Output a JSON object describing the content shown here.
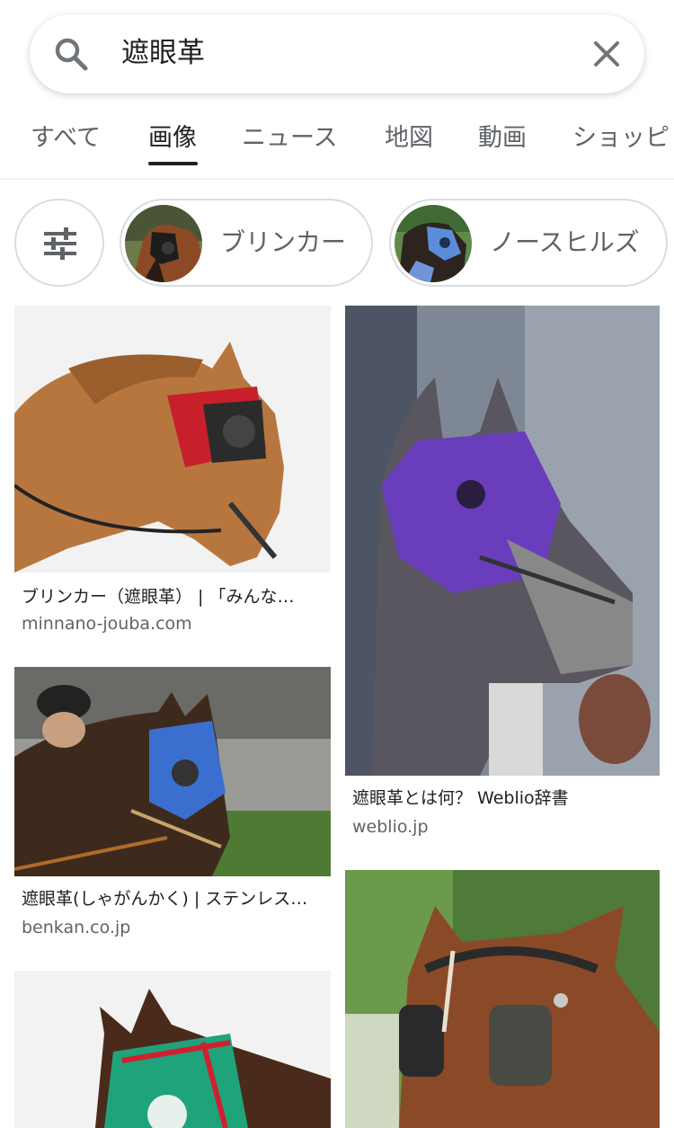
{
  "search": {
    "query": "遮眼革"
  },
  "tabs": [
    {
      "label": "すべて"
    },
    {
      "label": "画像"
    },
    {
      "label": "ニュース"
    },
    {
      "label": "地図"
    },
    {
      "label": "動画"
    },
    {
      "label": "ショッピ"
    }
  ],
  "active_tab": "画像",
  "chips": [
    {
      "label": "ブリンカー"
    },
    {
      "label": "ノースヒルズ"
    }
  ],
  "results": [
    {
      "title": "ブリンカー（遮眼革） | 「みんな…",
      "source": "minnano-jouba.com"
    },
    {
      "title": "遮眼革とは何？ Weblio辞書",
      "source": "weblio.jp"
    },
    {
      "title": "遮眼革(しゃがんかく) | ステンレス…",
      "source": "benkan.co.jp"
    },
    {
      "title": "",
      "source": ""
    },
    {
      "title": "",
      "source": ""
    }
  ],
  "colors": {
    "text_primary": "#202124",
    "text_secondary": "#5f6368",
    "chip_border": "#dadce0"
  }
}
